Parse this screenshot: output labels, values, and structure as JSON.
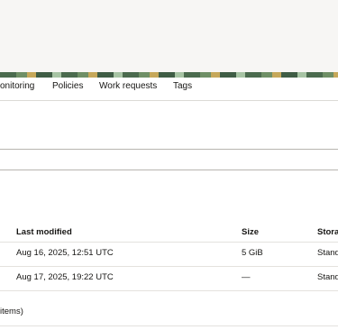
{
  "tabs": [
    "onitoring",
    "Policies",
    "Work requests",
    "Tags"
  ],
  "table": {
    "columns": {
      "last_modified": "Last modified",
      "size": "Size",
      "storage": "Storag"
    },
    "rows": [
      {
        "last_modified": "Aug 16, 2025, 12:51 UTC",
        "size": "5 GiB",
        "storage": "Stand"
      },
      {
        "last_modified": "Aug 17, 2025, 19:22 UTC",
        "size": "—",
        "storage": "Stand"
      }
    ]
  },
  "footer": {
    "items_text": "items)"
  }
}
